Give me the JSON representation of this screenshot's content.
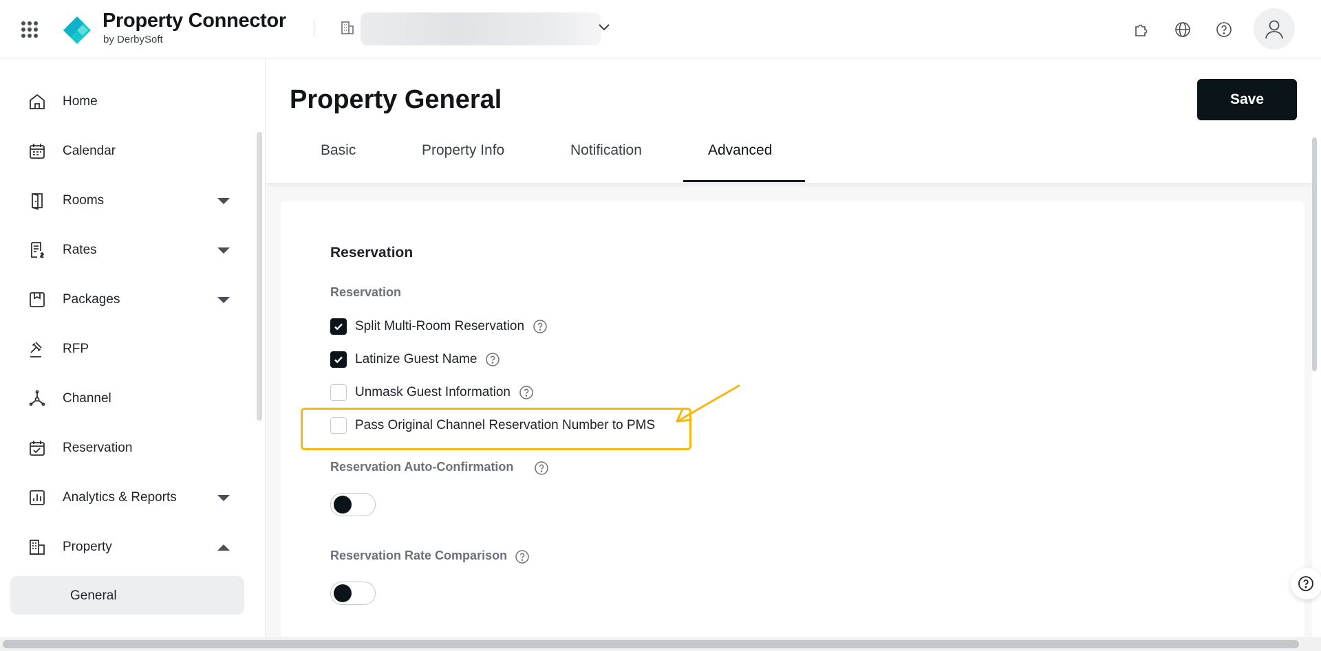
{
  "header": {
    "app_title": "Property Connector",
    "app_subtitle": "by DerbySoft",
    "icons": [
      "apps-grid-icon",
      "building-icon",
      "chevron-down-icon",
      "puzzle-icon",
      "globe-icon",
      "help-circle-icon",
      "user-avatar-icon"
    ]
  },
  "sidebar": {
    "items": [
      {
        "label": "Home",
        "icon": "home-icon",
        "expandable": false
      },
      {
        "label": "Calendar",
        "icon": "calendar-icon",
        "expandable": false
      },
      {
        "label": "Rooms",
        "icon": "door-icon",
        "expandable": true
      },
      {
        "label": "Rates",
        "icon": "rate-doc-icon",
        "expandable": true
      },
      {
        "label": "Packages",
        "icon": "package-icon",
        "expandable": true
      },
      {
        "label": "RFP",
        "icon": "gavel-icon",
        "expandable": false
      },
      {
        "label": "Channel",
        "icon": "channel-icon",
        "expandable": false
      },
      {
        "label": "Reservation",
        "icon": "calendar-check-icon",
        "expandable": false
      },
      {
        "label": "Analytics & Reports",
        "icon": "chart-icon",
        "expandable": true
      },
      {
        "label": "Property",
        "icon": "building-icon",
        "expandable": true,
        "expanded": true
      }
    ],
    "sub_items": [
      {
        "label": "General",
        "selected": true
      }
    ]
  },
  "main": {
    "page_title": "Property General",
    "save_label": "Save",
    "tabs": [
      {
        "label": "Basic",
        "active": false
      },
      {
        "label": "Property Info",
        "active": false
      },
      {
        "label": "Notification",
        "active": false
      },
      {
        "label": "Advanced",
        "active": true
      }
    ],
    "section_title": "Reservation",
    "group_label": "Reservation",
    "checkboxes": [
      {
        "label": "Split Multi-Room Reservation",
        "checked": true,
        "help": true
      },
      {
        "label": "Latinize Guest Name",
        "checked": true,
        "help": true
      },
      {
        "label": "Unmask Guest Information",
        "checked": false,
        "help": true
      },
      {
        "label": "Pass Original Channel Reservation Number to PMS",
        "checked": false,
        "help": false,
        "highlighted": true
      }
    ],
    "auto_confirmation": {
      "label": "Reservation Auto-Confirmation",
      "enabled": false
    },
    "rate_comparison": {
      "label": "Reservation Rate Comparison",
      "enabled": false
    }
  },
  "colors": {
    "brand_accent": "#12c9c9",
    "primary_dark": "#0b1419",
    "highlight": "#f6b80f"
  }
}
